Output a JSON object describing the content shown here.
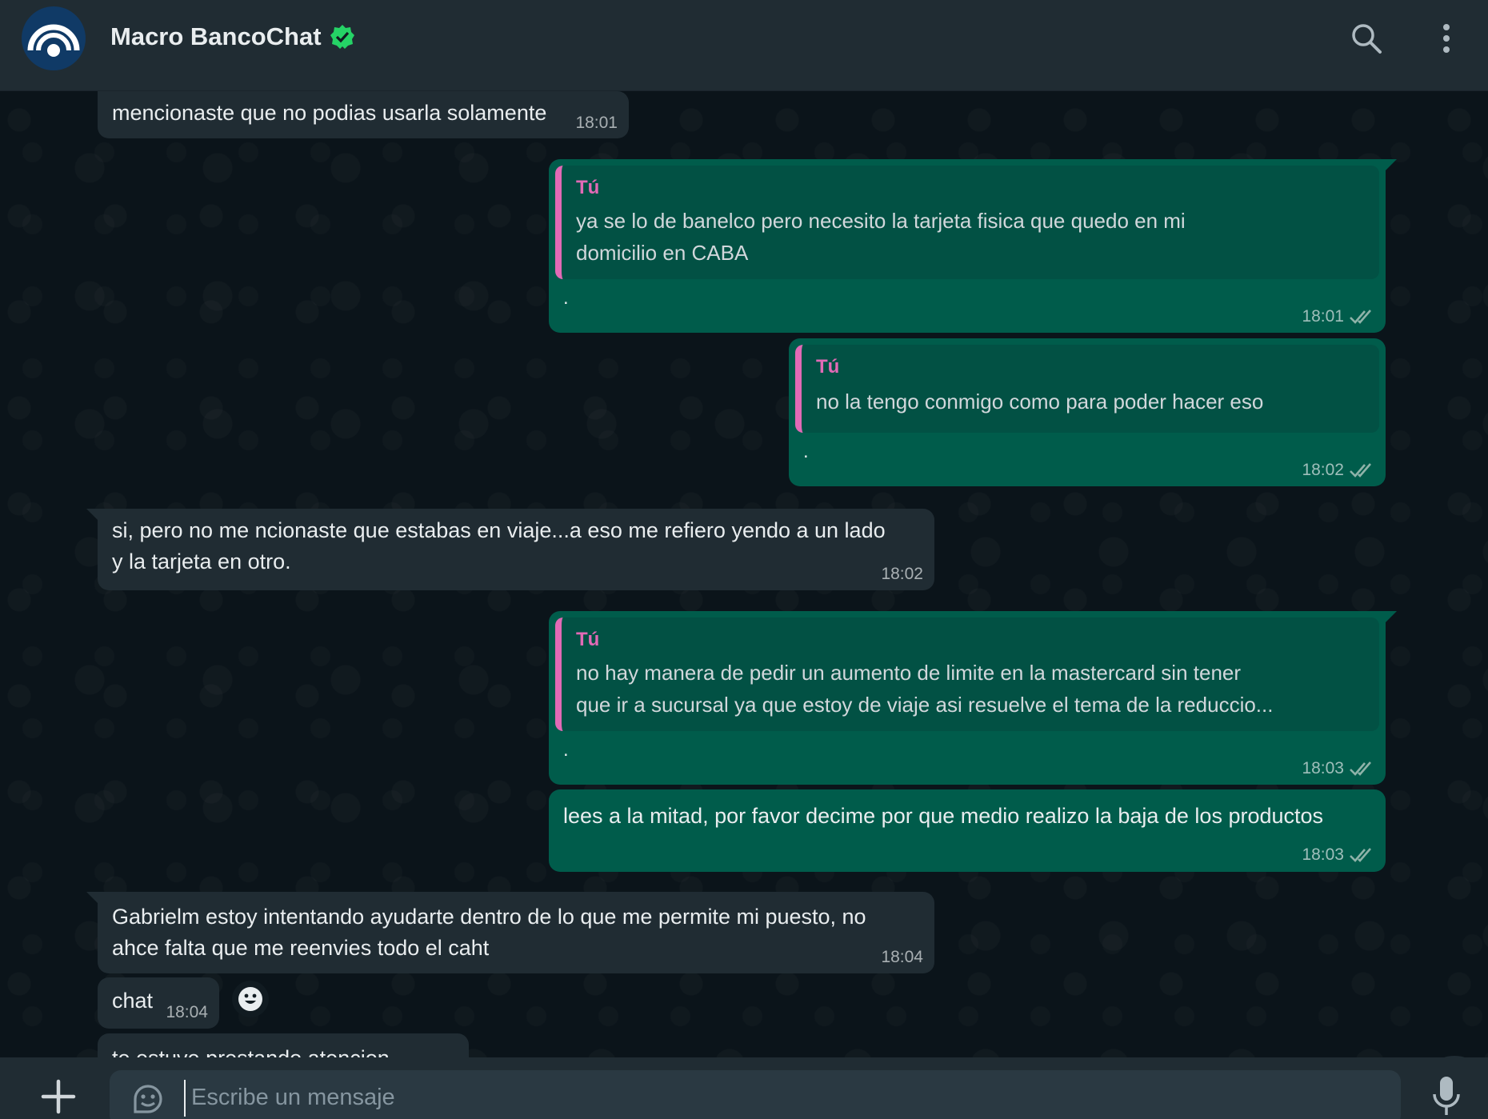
{
  "header": {
    "title": "Macro BancoChat",
    "verified": true,
    "icons": [
      "bank-logo-icon",
      "verified-badge-icon",
      "search-icon",
      "menu-dots-icon"
    ]
  },
  "messages": [
    {
      "dir": "in",
      "text": "mencionaste que no podias usarla solamente",
      "time": "18:01"
    },
    {
      "dir": "out",
      "quote_author": "Tú",
      "quote_lines": [
        "ya se lo de banelco pero necesito la tarjeta fisica que quedo en mi",
        "domicilio en CABA"
      ],
      "text": ".",
      "time": "18:01"
    },
    {
      "dir": "out",
      "quote_author": "Tú",
      "quote_lines": [
        "no la tengo conmigo como para poder hacer eso"
      ],
      "text": ".",
      "time": "18:02"
    },
    {
      "dir": "in",
      "lines": [
        "si, pero no me ncionaste que estabas en viaje...a eso me refiero yendo a un lado",
        "y la tarjeta en otro."
      ],
      "time": "18:02"
    },
    {
      "dir": "out",
      "quote_author": "Tú",
      "quote_lines": [
        "no hay manera de pedir un aumento de limite en la mastercard sin tener",
        "que ir a sucursal ya que estoy de viaje asi resuelve el tema de la reduccio..."
      ],
      "text": ".",
      "time": "18:03"
    },
    {
      "dir": "out",
      "text": "lees a la mitad, por favor decime por que medio realizo la baja de los productos",
      "time": "18:03"
    },
    {
      "dir": "in",
      "lines": [
        "Gabrielm estoy intentando ayudarte dentro de lo que me permite mi puesto, no",
        "ahce falta que me reenvies todo el caht"
      ],
      "time": "18:04"
    },
    {
      "dir": "in",
      "text": "chat",
      "time": "18:04"
    },
    {
      "dir": "in",
      "text": "te estuve prestando atencion",
      "time": ""
    }
  ],
  "composer": {
    "placeholder": "Escribe un mensaje"
  },
  "colors": {
    "header_bg": "#202c33",
    "chat_bg": "#0b141a",
    "incoming_bubble": "#202c33",
    "outgoing_bubble": "#005c4b",
    "quote_accent": "#e26ab6",
    "verified_green": "#25d366",
    "tick_color": "#8fb3a9"
  }
}
